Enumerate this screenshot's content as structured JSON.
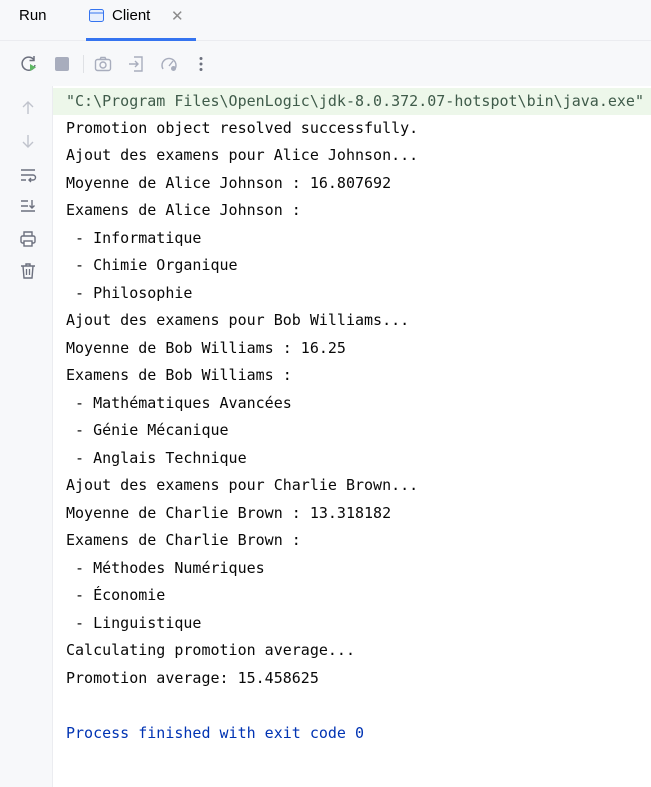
{
  "tabbar": {
    "run_label": "Run",
    "tab_title": "Client",
    "close_glyph": "✕"
  },
  "toolbar": {
    "icons": [
      "rerun-icon",
      "stop-icon",
      "camera-icon",
      "login-icon",
      "gauge-icon",
      "more-icon"
    ]
  },
  "gutter": {
    "icons": [
      "arrow-up-icon",
      "arrow-down-icon",
      "soft-wrap-icon",
      "scroll-end-icon",
      "print-icon",
      "trash-icon"
    ]
  },
  "console": {
    "command": "\"C:\\Program Files\\OpenLogic\\jdk-8.0.372.07-hotspot\\bin\\java.exe\"",
    "lines": [
      "Promotion object resolved successfully.",
      "Ajout des examens pour Alice Johnson...",
      "Moyenne de Alice Johnson : 16.807692",
      "Examens de Alice Johnson :",
      " - Informatique",
      " - Chimie Organique",
      " - Philosophie",
      "Ajout des examens pour Bob Williams...",
      "Moyenne de Bob Williams : 16.25",
      "Examens de Bob Williams :",
      " - Mathématiques Avancées",
      " - Génie Mécanique",
      " - Anglais Technique",
      "Ajout des examens pour Charlie Brown...",
      "Moyenne de Charlie Brown : 13.318182",
      "Examens de Charlie Brown :",
      " - Méthodes Numériques",
      " - Économie",
      " - Linguistique",
      "Calculating promotion average...",
      "Promotion average: 15.458625"
    ],
    "finish": "Process finished with exit code 0"
  },
  "colors": {
    "accent": "#3574f0",
    "command_bg": "#edf7ea",
    "finish_text": "#0033b3"
  }
}
